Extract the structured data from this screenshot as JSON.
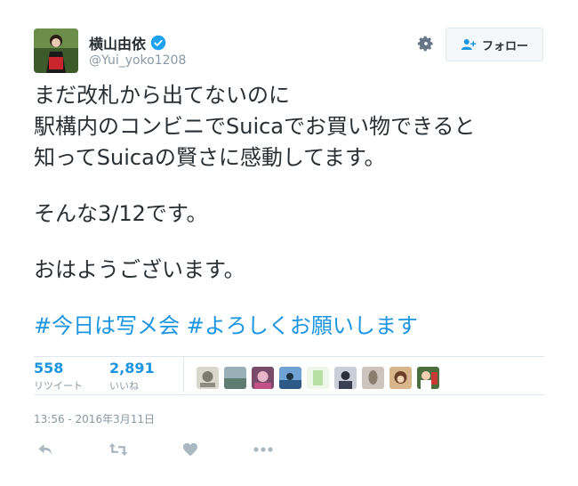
{
  "user": {
    "display_name": "横山由依",
    "handle": "@Yui_yoko1208",
    "verified": true
  },
  "follow_button": {
    "label": "フォロー"
  },
  "tweet": {
    "lines": [
      "まだ改札から出てないのに",
      "駅構内のコンビニでSuicaでお買い物できると",
      "知ってSuicaの賢さに感動してます。",
      "そんな3/12です。",
      "おはようございます。"
    ],
    "hashtags": [
      "#今日は写メ会",
      "#よろしくお願いします"
    ]
  },
  "stats": {
    "retweets": {
      "count": "558",
      "label": "リツイート"
    },
    "likes": {
      "count": "2,891",
      "label": "いいね"
    }
  },
  "timestamp": "13:56 - 2016年3月11日",
  "colors": {
    "link": "#1b95e0",
    "verified": "#1da1f2",
    "muted": "#8899a6",
    "text": "#292f33",
    "border": "#e1e8ed"
  },
  "icons": {
    "reply": "reply-icon",
    "retweet": "retweet-icon",
    "like": "heart-icon",
    "more": "more-icon",
    "settings": "gear-icon",
    "follow": "follow-user-icon"
  }
}
